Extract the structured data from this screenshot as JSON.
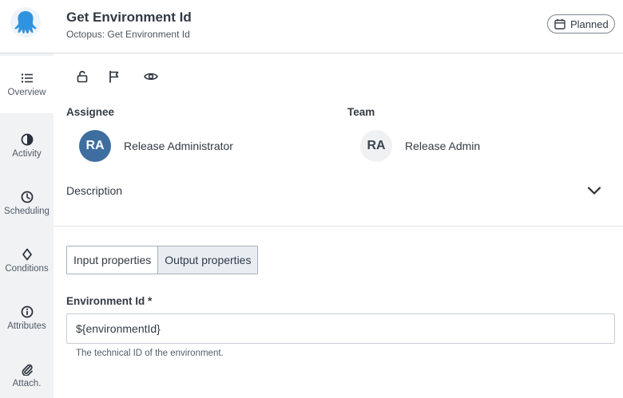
{
  "header": {
    "title": "Get Environment Id",
    "subtitle": "Octopus: Get Environment Id",
    "status": "Planned"
  },
  "sidebar": {
    "items": [
      {
        "label": "Overview",
        "icon": "list-icon"
      },
      {
        "label": "Activity",
        "icon": "pie-chart-icon"
      },
      {
        "label": "Scheduling",
        "icon": "clock-icon"
      },
      {
        "label": "Conditions",
        "icon": "diamond-icon"
      },
      {
        "label": "Attributes",
        "icon": "info-icon"
      },
      {
        "label": "Attach.",
        "icon": "paperclip-icon"
      }
    ]
  },
  "toolbar": {
    "icons": [
      "unlock-icon",
      "flag-icon",
      "eye-icon"
    ]
  },
  "assignee": {
    "label": "Assignee",
    "initials": "RA",
    "name": "Release Administrator"
  },
  "team": {
    "label": "Team",
    "initials": "RA",
    "name": "Release Admin"
  },
  "description": {
    "label": "Description"
  },
  "tabs": [
    {
      "label": "Input properties"
    },
    {
      "label": "Output properties"
    }
  ],
  "form": {
    "field_label": "Environment Id *",
    "field_value": "${environmentId}",
    "helper_text": "The technical ID of the environment."
  },
  "colors": {
    "avatar_dark": "#3e6d9f",
    "logo": "#2f93e0"
  }
}
